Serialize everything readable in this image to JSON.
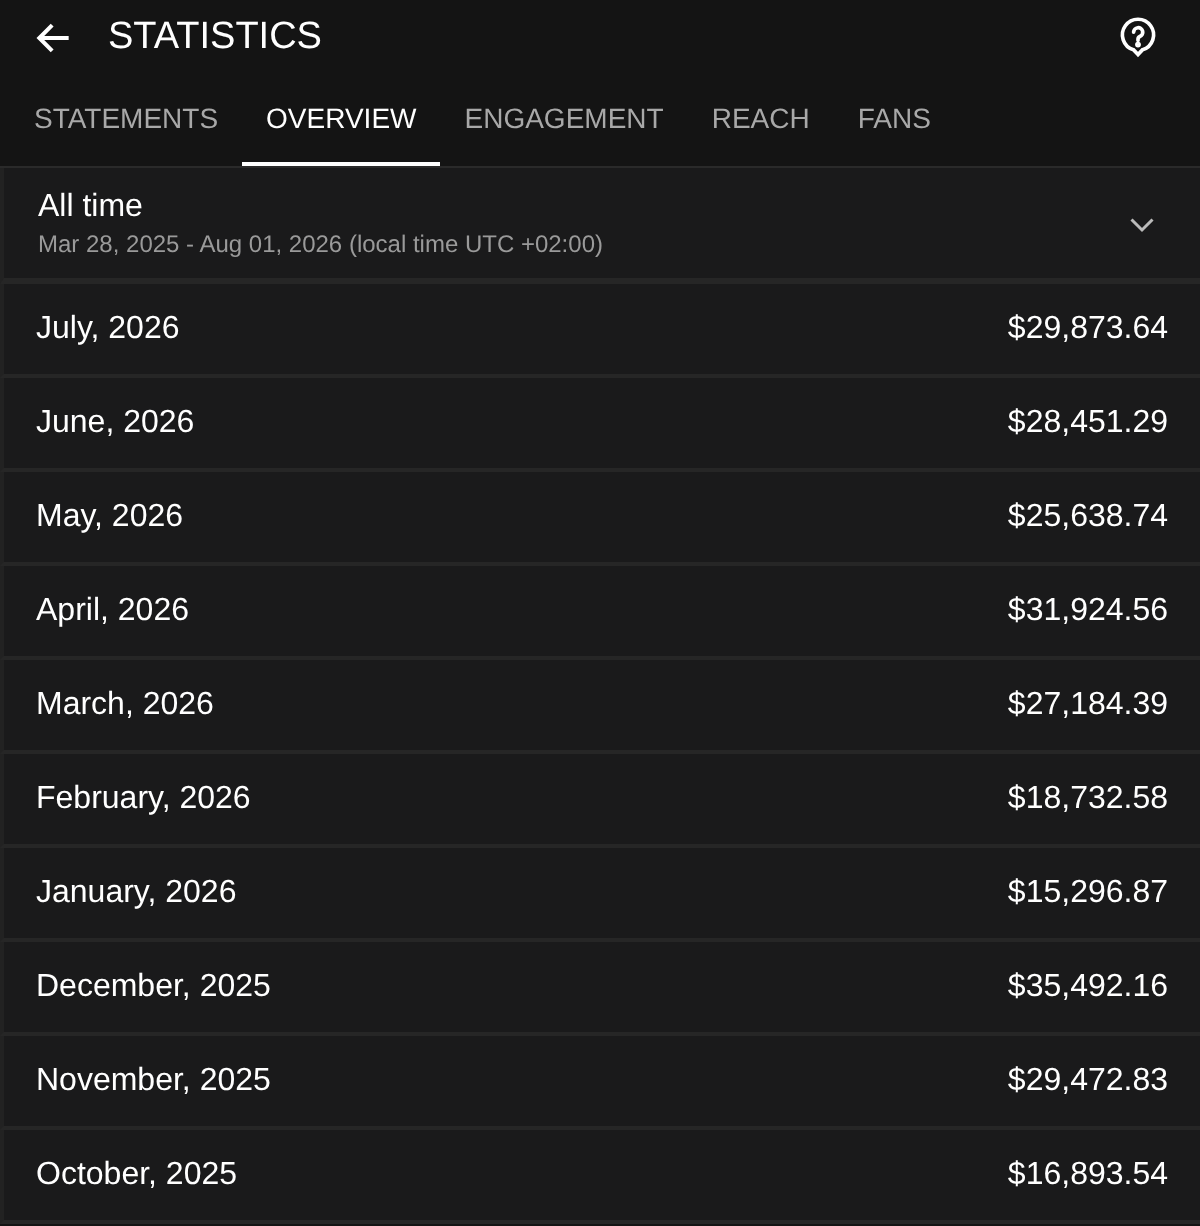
{
  "header": {
    "title": "STATISTICS"
  },
  "tabs": [
    {
      "label": "STATEMENTS",
      "selected": false
    },
    {
      "label": "OVERVIEW",
      "selected": true
    },
    {
      "label": "ENGAGEMENT",
      "selected": false
    },
    {
      "label": "REACH",
      "selected": false
    },
    {
      "label": "FANS",
      "selected": false
    }
  ],
  "period": {
    "title": "All time",
    "range": "Mar 28, 2025 - Aug 01, 2026 (local time UTC +02:00)"
  },
  "rows": [
    {
      "month": "July, 2026",
      "amount": "$29,873.64"
    },
    {
      "month": "June, 2026",
      "amount": "$28,451.29"
    },
    {
      "month": "May, 2026",
      "amount": "$25,638.74"
    },
    {
      "month": "April, 2026",
      "amount": "$31,924.56"
    },
    {
      "month": "March, 2026",
      "amount": "$27,184.39"
    },
    {
      "month": "February, 2026",
      "amount": "$18,732.58"
    },
    {
      "month": "January, 2026",
      "amount": "$15,296.87"
    },
    {
      "month": "December, 2025",
      "amount": "$35,492.16"
    },
    {
      "month": "November, 2025",
      "amount": "$29,472.83"
    },
    {
      "month": "October, 2025",
      "amount": "$16,893.54"
    }
  ]
}
